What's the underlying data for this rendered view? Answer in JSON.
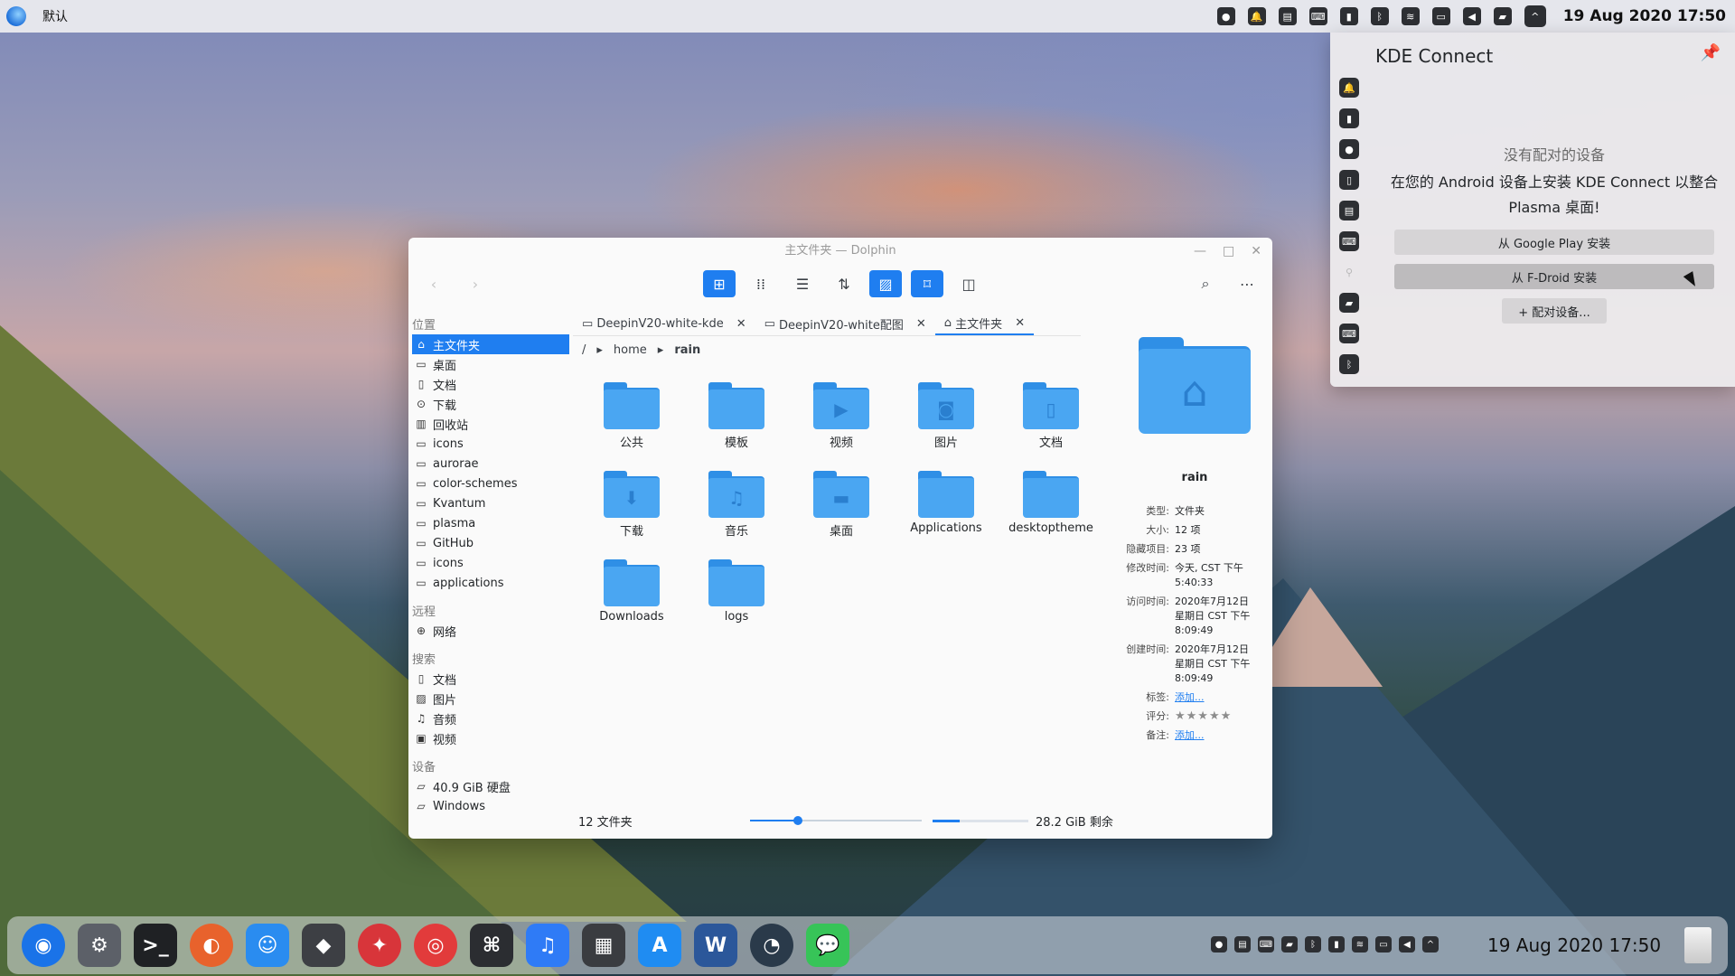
{
  "topbar": {
    "app_name": "默认",
    "clock": "19 Aug 2020 17:50",
    "tray_icons": [
      "record-icon",
      "notification-icon",
      "clipboard-icon",
      "keyboard-icon",
      "phone-icon",
      "bluetooth-icon",
      "wifi-icon",
      "display-icon",
      "volume-icon",
      "battery-icon",
      "expand-tray-icon"
    ]
  },
  "window": {
    "title": "主文件夹 — Dolphin",
    "toolbar": [
      "back-icon",
      "forward-icon",
      "icons-view-icon",
      "compact-view-icon",
      "details-view-icon",
      "sort-icon",
      "preview-icon",
      "bookmark-icon",
      "split-view-icon",
      "search-icon",
      "menu-icon"
    ]
  },
  "sidebar": {
    "sections": [
      {
        "title": "位置",
        "items": [
          {
            "label": "主文件夹",
            "icon": "home-icon",
            "selected": true
          },
          {
            "label": "桌面",
            "icon": "desktop-icon"
          },
          {
            "label": "文档",
            "icon": "document-icon"
          },
          {
            "label": "下载",
            "icon": "download-icon"
          },
          {
            "label": "回收站",
            "icon": "trash-icon"
          },
          {
            "label": "icons",
            "icon": "folder-icon"
          },
          {
            "label": "aurorae",
            "icon": "folder-icon"
          },
          {
            "label": "color-schemes",
            "icon": "folder-icon"
          },
          {
            "label": "Kvantum",
            "icon": "folder-icon"
          },
          {
            "label": "plasma",
            "icon": "folder-icon"
          },
          {
            "label": "GitHub",
            "icon": "folder-icon"
          },
          {
            "label": "icons",
            "icon": "folder-icon"
          },
          {
            "label": "applications",
            "icon": "folder-icon"
          }
        ]
      },
      {
        "title": "远程",
        "items": [
          {
            "label": "网络",
            "icon": "network-icon"
          }
        ]
      },
      {
        "title": "搜索",
        "items": [
          {
            "label": "文档",
            "icon": "document-icon"
          },
          {
            "label": "图片",
            "icon": "image-icon"
          },
          {
            "label": "音频",
            "icon": "music-icon"
          },
          {
            "label": "视频",
            "icon": "video-icon"
          }
        ]
      },
      {
        "title": "设备",
        "items": [
          {
            "label": "40.9 GiB 硬盘",
            "icon": "drive-icon"
          },
          {
            "label": "Windows",
            "icon": "drive-icon"
          }
        ]
      }
    ]
  },
  "tabs": [
    {
      "label": "DeepinV20-white-kde",
      "icon": "folder-icon"
    },
    {
      "label": "DeepinV20-white配图",
      "icon": "folder-icon"
    },
    {
      "label": "主文件夹",
      "icon": "home-icon",
      "current": true
    }
  ],
  "breadcrumb": [
    "/",
    "home",
    "rain"
  ],
  "files": [
    {
      "label": "公共",
      "icon": ""
    },
    {
      "label": "模板",
      "icon": ""
    },
    {
      "label": "视频",
      "icon": "▶"
    },
    {
      "label": "图片",
      "icon": "◙"
    },
    {
      "label": "文档",
      "icon": "▯"
    },
    {
      "label": "下载",
      "icon": "⬇"
    },
    {
      "label": "音乐",
      "icon": "♫"
    },
    {
      "label": "桌面",
      "icon": "▬"
    },
    {
      "label": "Applications",
      "icon": ""
    },
    {
      "label": "desktoptheme",
      "icon": ""
    },
    {
      "label": "Downloads",
      "icon": ""
    },
    {
      "label": "logs",
      "icon": ""
    }
  ],
  "status": {
    "count": "12 文件夹",
    "zoom_fraction": 0.28,
    "free_space": "28.2 GiB 剩余",
    "used_fraction": 0.28
  },
  "info": {
    "name": "rain",
    "props": [
      {
        "k": "类型:",
        "v": "文件夹"
      },
      {
        "k": "大小:",
        "v": "12 项"
      },
      {
        "k": "隐藏项目:",
        "v": "23 项"
      },
      {
        "k": "修改时间:",
        "v": "今天, CST 下午 5:40:33"
      },
      {
        "k": "访问时间:",
        "v": "2020年7月12日星期日 CST 下午 8:09:49"
      },
      {
        "k": "创建时间:",
        "v": "2020年7月12日星期日 CST 下午 8:09:49"
      },
      {
        "k": "标签:",
        "v": "添加...",
        "link": true
      },
      {
        "k": "评分:",
        "v": "★★★★★",
        "stars": true
      },
      {
        "k": "备注:",
        "v": "添加...",
        "link": true
      }
    ]
  },
  "kde": {
    "title": "KDE Connect",
    "no_device": "没有配对的设备",
    "message": "在您的 Android 设备上安装 KDE Connect 以整合 Plasma 桌面!",
    "btn_play": "从 Google Play 安装",
    "btn_fdroid": "从 F-Droid 安装",
    "btn_pair": "+ 配对设备...",
    "side_icons": [
      "notification-icon",
      "remote-icon",
      "record-icon",
      "phone-icon",
      "clipboard-icon",
      "keyboard-icon",
      "location-icon",
      "battery-icon",
      "keyboard2-icon",
      "bluetooth-icon"
    ]
  },
  "dock": {
    "apps": [
      {
        "name": "deepin-launcher",
        "color": "#1a73e8"
      },
      {
        "name": "settings",
        "color": "#5c6068"
      },
      {
        "name": "terminal",
        "color": "#1f2124"
      },
      {
        "name": "firefox",
        "color": "#e8622c"
      },
      {
        "name": "finder",
        "color": "#2a8cf0"
      },
      {
        "name": "inkscape",
        "color": "#3d3f44"
      },
      {
        "name": "safari",
        "color": "#d8353a"
      },
      {
        "name": "netease-music",
        "color": "#e23b3b"
      },
      {
        "name": "github",
        "color": "#2b2d31"
      },
      {
        "name": "music",
        "color": "#2f7bf6"
      },
      {
        "name": "calculator",
        "color": "#3a3c40"
      },
      {
        "name": "app-store",
        "color": "#1f8cf2"
      },
      {
        "name": "word",
        "color": "#2b579a"
      },
      {
        "name": "dashboard",
        "color": "#2a3a4a"
      },
      {
        "name": "messages",
        "color": "#37c458"
      }
    ],
    "clock": "19 Aug 2020 17:50"
  }
}
